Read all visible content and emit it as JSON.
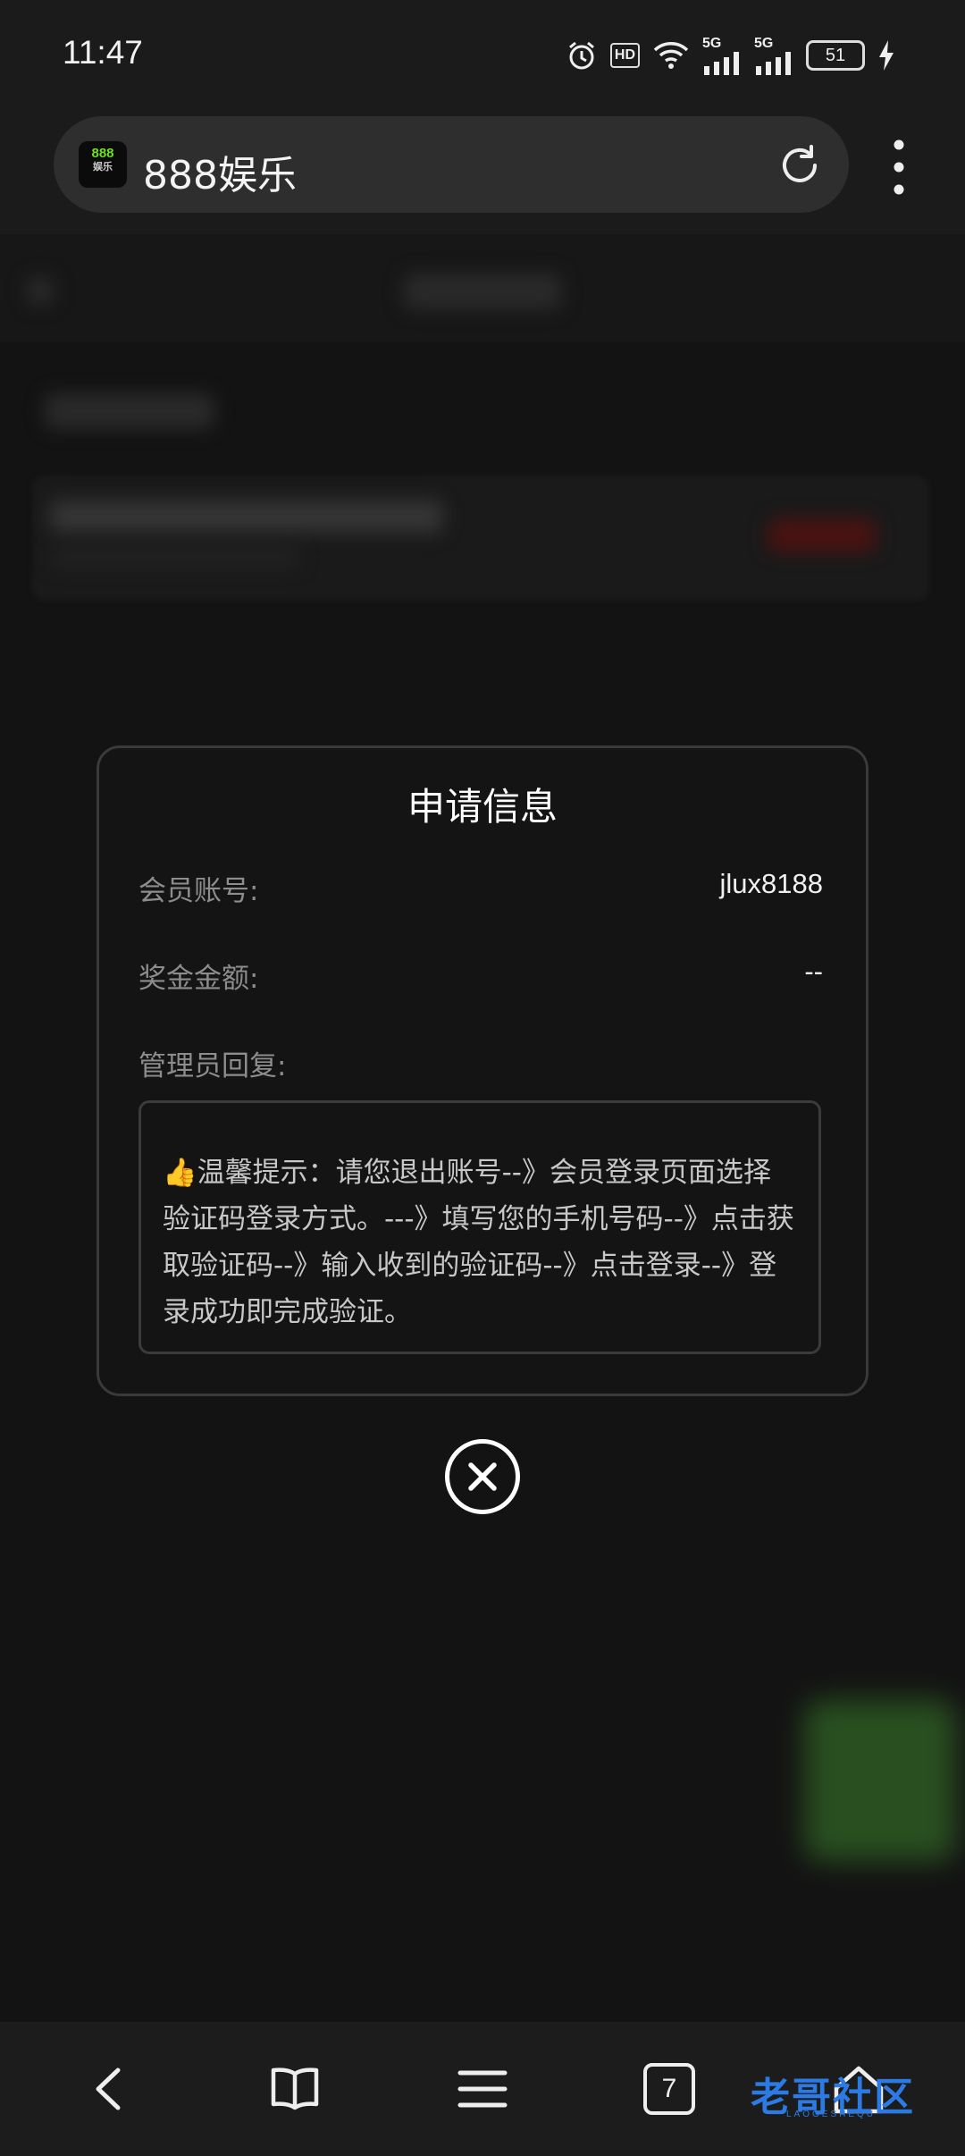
{
  "status_bar": {
    "time": "11:47",
    "hd_label": "HD",
    "signal1_label": "5G",
    "signal2_label": "5G",
    "battery_level": "51"
  },
  "browser": {
    "favicon_text": "888",
    "favicon_sub": "娱乐",
    "site_title": "888娱乐"
  },
  "modal": {
    "title": "申请信息",
    "member_label": "会员账号:",
    "member_value": "jlux8188",
    "bonus_label": "奖金金额:",
    "bonus_value": "--",
    "admin_reply_label": "管理员回复:",
    "admin_reply_text": "👍温馨提示：请您退出账号--》会员登录页面选择验证码登录方式。---》填写您的手机号码--》点击获取验证码--》输入收到的验证码--》点击登录--》登录成功即完成验证。"
  },
  "nav": {
    "tab_count": "7"
  },
  "watermark": {
    "text": "老哥社区",
    "sub": "LAOGESHEQU"
  }
}
